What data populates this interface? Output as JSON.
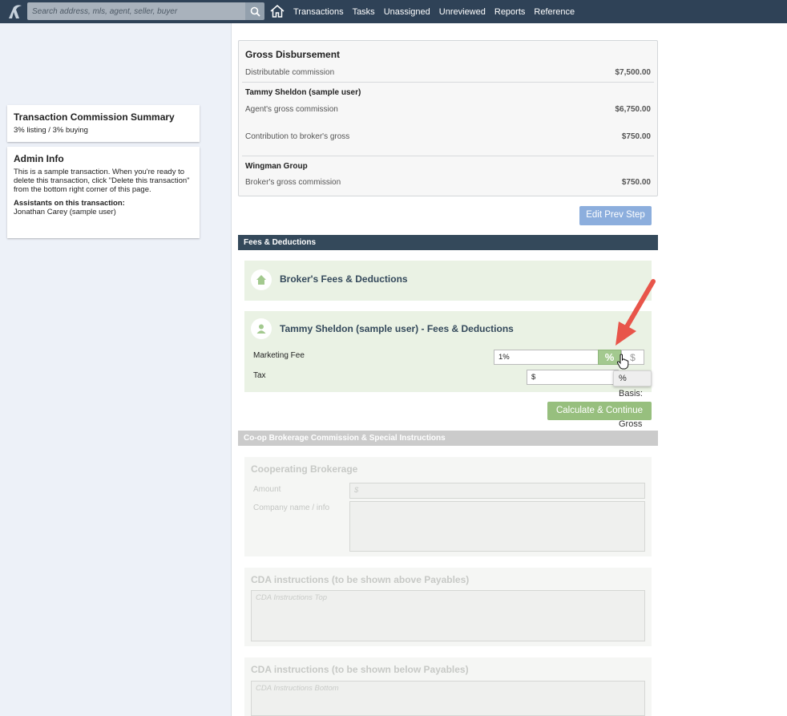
{
  "nav": {
    "search_placeholder": "Search address, mls, agent, seller, buyer",
    "items": [
      "Transactions",
      "Tasks",
      "Unassigned",
      "Unreviewed",
      "Reports",
      "Reference"
    ]
  },
  "sidebar": {
    "summary": {
      "title": "Transaction Commission Summary",
      "detail": "3% listing / 3% buying"
    },
    "admin": {
      "title": "Admin Info",
      "body": "This is a sample transaction. When you're ready to delete this transaction, click \"Delete this transaction\" from the bottom right corner of this page.",
      "assistants_label": "Assistants on this transaction:",
      "assistants": "Jonathan Carey (sample user)"
    }
  },
  "gross": {
    "title": "Gross Disbursement",
    "distributable_label": "Distributable commission",
    "distributable_value": "$7,500.00",
    "agent_name": "Tammy Sheldon (sample user)",
    "agent_gross_label": "Agent's gross commission",
    "agent_gross_value": "$6,750.00",
    "contribution_label": "Contribution to broker's gross",
    "contribution_value": "$750.00",
    "broker_name": "Wingman Group",
    "broker_gross_label": "Broker's gross commission",
    "broker_gross_value": "$750.00",
    "edit_button": "Edit Prev Step"
  },
  "fees": {
    "section_title": "Fees & Deductions",
    "broker_title": "Broker's Fees & Deductions",
    "agent_title": "Tammy Sheldon (sample user) - Fees & Deductions",
    "marketing_label": "Marketing Fee",
    "marketing_value": "1%",
    "percent_symbol": "%",
    "dollar_symbol": "$",
    "tax_label": "Tax",
    "tax_value": "$",
    "tooltip": "% Basis: Agent Gross",
    "calc_button": "Calculate & Continue"
  },
  "coop": {
    "section_title": "Co-op Brokerage Commission & Special Instructions",
    "brokerage_title": "Cooperating Brokerage",
    "amount_label": "Amount",
    "amount_placeholder": "$",
    "company_label": "Company name / info",
    "cda_above_title": "CDA instructions (to be shown above Payables)",
    "cda_top_placeholder": "CDA Instructions Top",
    "cda_below_title": "CDA instructions (to be shown below Payables)",
    "cda_bottom_placeholder": "CDA Instructions Bottom"
  },
  "colors": {
    "nav": "#2f4257",
    "section_dark": "#34495b",
    "green_button": "#97bf7e",
    "blue_button": "#8caedd",
    "arrow": "#e8554a"
  }
}
